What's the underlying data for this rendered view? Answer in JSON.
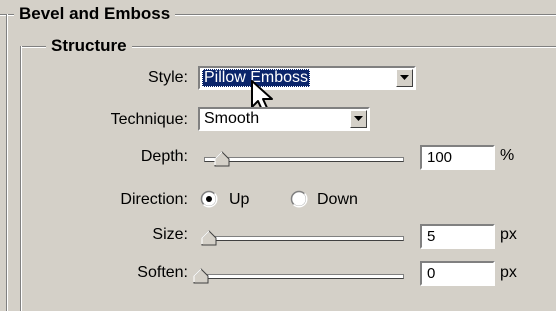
{
  "panel": {
    "title": "Bevel and Emboss",
    "structure_title": "Structure",
    "style": {
      "label": "Style:",
      "value": "Pillow Emboss"
    },
    "technique": {
      "label": "Technique:",
      "value": "Smooth"
    },
    "depth": {
      "label": "Depth:",
      "value": "100",
      "unit": "%",
      "slider_fraction": 0.04
    },
    "direction": {
      "label": "Direction:",
      "options": [
        "Up",
        "Down"
      ],
      "selected": "Up"
    },
    "size": {
      "label": "Size:",
      "value": "5",
      "unit": "px",
      "slider_fraction": 0.02
    },
    "soften": {
      "label": "Soften:",
      "value": "0",
      "unit": "px",
      "slider_fraction": 0.0
    }
  }
}
